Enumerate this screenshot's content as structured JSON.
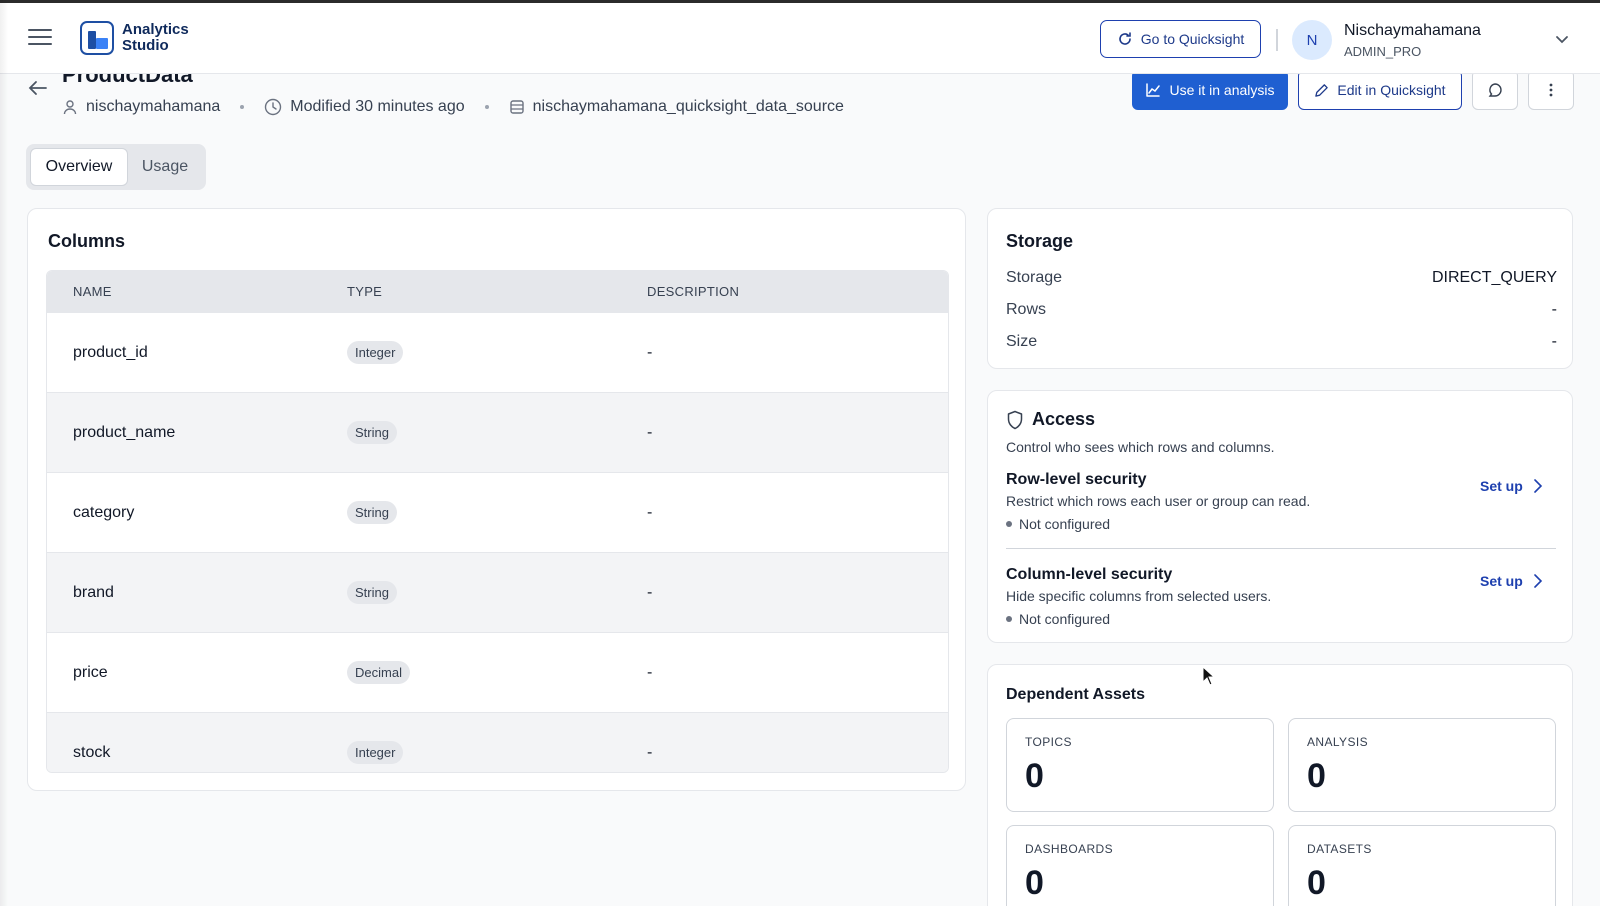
{
  "header": {
    "app_name": "Analytics Studio",
    "quicksight_button": "Go to Quicksight",
    "user": {
      "initial": "N",
      "name": "Nischaymahamana",
      "role": "ADMIN_PRO"
    }
  },
  "dataset": {
    "title": "ProductData",
    "owner": "nischaymahamana",
    "modified": "Modified 30 minutes ago",
    "data_source": "nischaymahamana_quicksight_data_source"
  },
  "actions": {
    "use_in_analysis": "Use it in analysis",
    "edit_in_quicksight": "Edit in Quicksight"
  },
  "tabs": [
    {
      "label": "Overview",
      "active": true
    },
    {
      "label": "Usage",
      "active": false
    }
  ],
  "columns": {
    "title": "Columns",
    "headers": [
      "NAME",
      "TYPE",
      "DESCRIPTION"
    ],
    "rows": [
      {
        "name": "product_id",
        "type": "Integer",
        "description": "-"
      },
      {
        "name": "product_name",
        "type": "String",
        "description": "-"
      },
      {
        "name": "category",
        "type": "String",
        "description": "-"
      },
      {
        "name": "brand",
        "type": "String",
        "description": "-"
      },
      {
        "name": "price",
        "type": "Decimal",
        "description": "-"
      },
      {
        "name": "stock",
        "type": "Integer",
        "description": "-"
      }
    ]
  },
  "storage": {
    "title": "Storage",
    "items": [
      {
        "label": "Storage",
        "value": "DIRECT_QUERY"
      },
      {
        "label": "Rows",
        "value": "-"
      },
      {
        "label": "Size",
        "value": "-"
      }
    ]
  },
  "access": {
    "title": "Access",
    "subtitle": "Control who sees which rows and columns.",
    "row_level": {
      "title": "Row-level security",
      "description": "Restrict which rows each user or group can read.",
      "status": "Not configured",
      "action": "Set up"
    },
    "column_level": {
      "title": "Column-level security",
      "description": "Hide specific columns from selected users.",
      "status": "Not configured",
      "action": "Set up"
    }
  },
  "dependent_assets": {
    "title": "Dependent Assets",
    "tiles": [
      {
        "label": "TOPICS",
        "value": "0"
      },
      {
        "label": "ANALYSIS",
        "value": "0"
      },
      {
        "label": "DASHBOARDS",
        "value": "0"
      },
      {
        "label": "DATASETS",
        "value": "0"
      }
    ]
  },
  "colors": {
    "primary": "#1f5fd1",
    "brand_dark": "#1e4fa3",
    "link": "#1e40af"
  }
}
